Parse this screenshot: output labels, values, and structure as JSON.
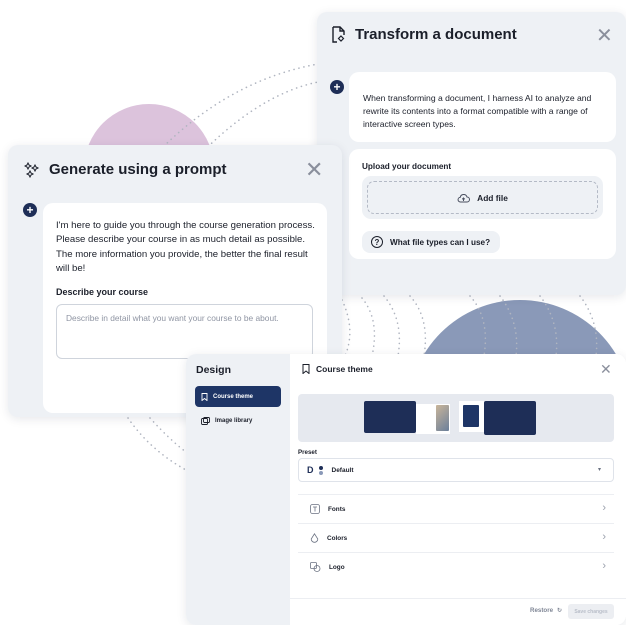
{
  "transform_dialog": {
    "title": "Transform a document",
    "message": "When transforming a document, I harness AI to analyze and rewrite its contents into a format compatible with a range of interactive screen types.",
    "upload_label": "Upload your document",
    "add_file_label": "Add file",
    "faq_label": "What file types can I use?"
  },
  "generate_dialog": {
    "title": "Generate using a prompt",
    "intro": "I'm here to guide you through the course generation process. Please describe your course in as much detail as possible. The more information you provide, the better the final result will be!",
    "describe_label": "Describe your course",
    "describe_placeholder": "Describe in detail what you want your course to be about."
  },
  "design_panel": {
    "title": "Design",
    "sidebar_items": [
      {
        "label": "Course theme",
        "icon": "bookmark-icon",
        "active": true
      },
      {
        "label": "Image library",
        "icon": "image-library-icon",
        "active": false
      }
    ],
    "header_title": "Course theme",
    "preset_label": "Preset",
    "preset_value": "Default",
    "preset_badge": "D",
    "options": [
      {
        "label": "Fonts",
        "icon": "font-icon"
      },
      {
        "label": "Colors",
        "icon": "droplet-icon"
      },
      {
        "label": "Logo",
        "icon": "logo-icon"
      }
    ],
    "restore_label": "Restore",
    "save_label": "Save changes"
  },
  "colors": {
    "brand_navy": "#1e3566",
    "accent_dark": "#1e2e57",
    "decor_purple": "#dcc3dc",
    "decor_blue": "#8a99b8"
  }
}
